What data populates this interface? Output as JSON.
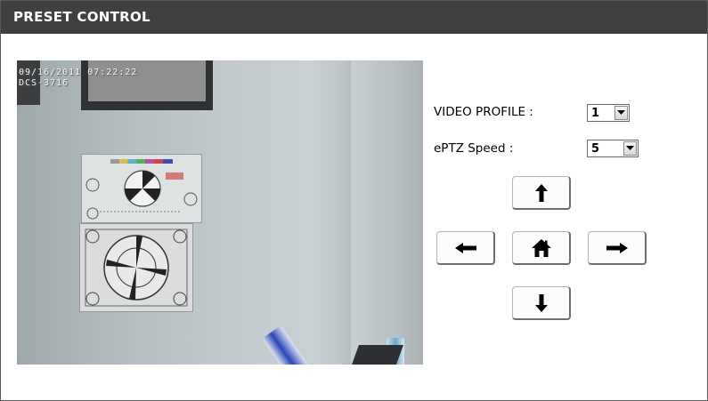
{
  "header": {
    "title": "PRESET CONTROL"
  },
  "video": {
    "timestamp_line1": "09/16/2011 07:22:22",
    "timestamp_line2": "DCS-3716"
  },
  "controls": {
    "video_profile": {
      "label": "VIDEO PROFILE  :",
      "value": "1"
    },
    "eptz_speed": {
      "label": "ePTZ Speed  :",
      "value": "5"
    }
  },
  "ptz_buttons": {
    "up": "arrow-up-icon",
    "left": "arrow-left-icon",
    "home": "home-icon",
    "right": "arrow-right-icon",
    "down": "arrow-down-icon"
  },
  "colors": {
    "header_bg": "#404040",
    "header_text": "#ffffff"
  }
}
